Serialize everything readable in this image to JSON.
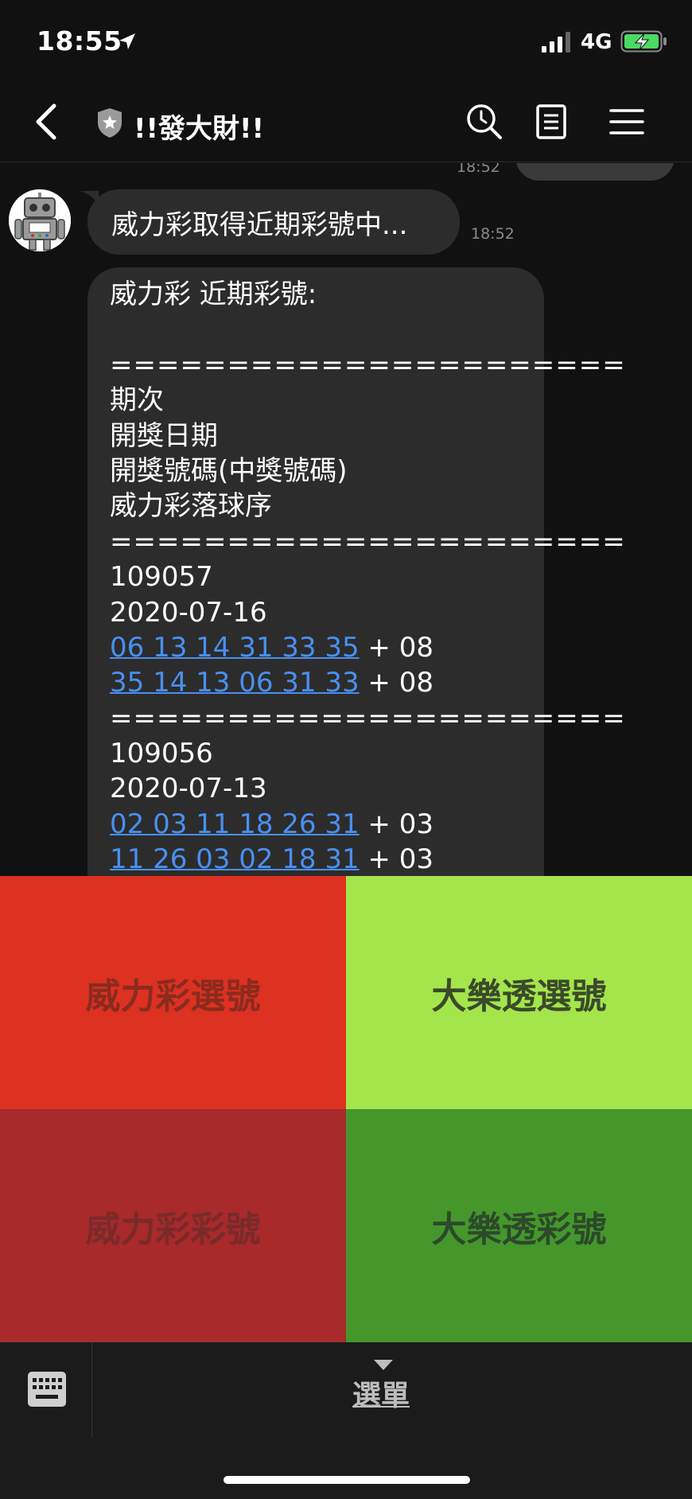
{
  "status_bar": {
    "time": "18:55",
    "network": "4G"
  },
  "header": {
    "title": "!!發大財!!"
  },
  "chat": {
    "prev_time": "18:52",
    "message1": {
      "text": "威力彩取得近期彩號中...",
      "time": "18:52"
    },
    "message2": {
      "lines": [
        {
          "text": "威力彩 近期彩號:"
        },
        {
          "text": ""
        },
        {
          "text": "======================",
          "sep": true
        },
        {
          "text": "期次"
        },
        {
          "text": "開獎日期"
        },
        {
          "text": "開獎號碼(中獎號碼)"
        },
        {
          "text": "威力彩落球序"
        },
        {
          "text": "======================",
          "sep": true
        },
        {
          "text": "109057"
        },
        {
          "text": "2020-07-16"
        },
        {
          "link": "06 13 14 31 33 35",
          "suffix": " + 08"
        },
        {
          "link": "35 14 13 06 31 33",
          "suffix": " + 08"
        },
        {
          "text": "======================",
          "sep": true
        },
        {
          "text": "109056"
        },
        {
          "text": "2020-07-13"
        },
        {
          "link": "02 03 11 18 26 31",
          "suffix": " + 03"
        },
        {
          "link": "11 26 03 02 18 31",
          "suffix": " + 03"
        }
      ]
    }
  },
  "richmenu": {
    "tiles": [
      {
        "label": "威力彩選號",
        "color": "#dd3121"
      },
      {
        "label": "大樂透選號",
        "color": "#a4e54c"
      },
      {
        "label": "威力彩彩號",
        "color": "#a82a2a"
      },
      {
        "label": "大樂透彩號",
        "color": "#45972c"
      }
    ]
  },
  "bottom": {
    "menu_label": "選單"
  },
  "icons": {
    "location": "location-arrow-icon",
    "signal": "signal-icon",
    "battery": "battery-charging-icon",
    "back": "chevron-left-icon",
    "shield": "shield-star-icon",
    "search": "search-icon",
    "notes": "notes-icon",
    "menu": "hamburger-menu-icon",
    "keyboard": "keyboard-icon",
    "caret": "caret-down-icon"
  }
}
